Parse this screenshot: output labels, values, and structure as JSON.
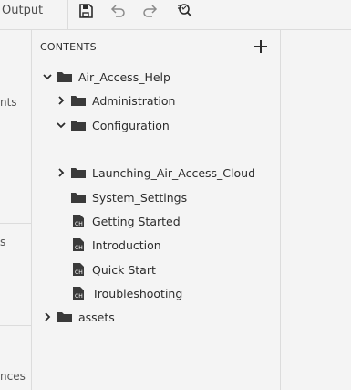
{
  "toolbar": {
    "output_label": "Output",
    "buttons": [
      {
        "name": "save-icon"
      },
      {
        "name": "undo-icon"
      },
      {
        "name": "redo-icon"
      },
      {
        "name": "find-replace-icon"
      }
    ]
  },
  "left_strip": {
    "frag1": "nts",
    "frag2": "s",
    "frag3": "nces"
  },
  "contents": {
    "title": "CONTENTS",
    "add_button": "add-icon",
    "tree": [
      {
        "label": "Air_Access_Help",
        "type": "folder",
        "expanded": true
      },
      {
        "label": "Administration",
        "type": "folder",
        "expanded": false
      },
      {
        "label": "Configuration",
        "type": "folder",
        "expanded": true
      },
      {
        "label": "Launching_Air_Access_Cloud",
        "type": "folder",
        "expanded": false
      },
      {
        "label": "System_Settings",
        "type": "folder"
      },
      {
        "label": "Getting Started",
        "type": "topic"
      },
      {
        "label": "Introduction",
        "type": "topic"
      },
      {
        "label": "Quick Start",
        "type": "topic"
      },
      {
        "label": "Troubleshooting",
        "type": "topic"
      },
      {
        "label": "assets",
        "type": "folder",
        "expanded": false
      }
    ]
  }
}
